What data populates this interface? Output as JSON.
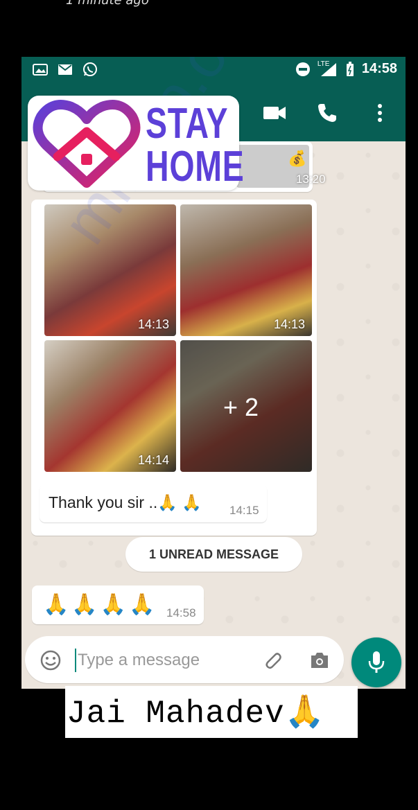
{
  "top_caption": "1 minute ago",
  "status_bar": {
    "network": "LTE",
    "time": "14:58",
    "icons": [
      "gallery-icon",
      "gmail-icon",
      "whatsapp-icon",
      "dnd-icon",
      "signal-icon",
      "battery-icon"
    ]
  },
  "app_bar": {
    "icons": [
      "video-call-icon",
      "voice-call-icon",
      "more-options-icon"
    ]
  },
  "sticker": {
    "line1": "STAY",
    "line2": "HOME",
    "colors": {
      "purple": "#5c40d8",
      "pink": "#e6205f"
    }
  },
  "messages": {
    "first_time": "13:20",
    "photos": [
      {
        "time": "14:13"
      },
      {
        "time": "14:13"
      },
      {
        "time": "14:14"
      },
      {
        "more_count": "+ 2"
      }
    ],
    "thank": {
      "text": "Thank you sir ..🙏 🙏",
      "time": "14:15"
    },
    "unread": "1 UNREAD MESSAGE",
    "pray": {
      "text": "🙏🙏🙏🙏",
      "time": "14:58"
    }
  },
  "input": {
    "placeholder": "Type a message"
  },
  "caption": "Jai Mahadev🙏",
  "colors": {
    "header": "#075e54",
    "accent": "#00897b",
    "wallpaper": "#ece5dd"
  }
}
